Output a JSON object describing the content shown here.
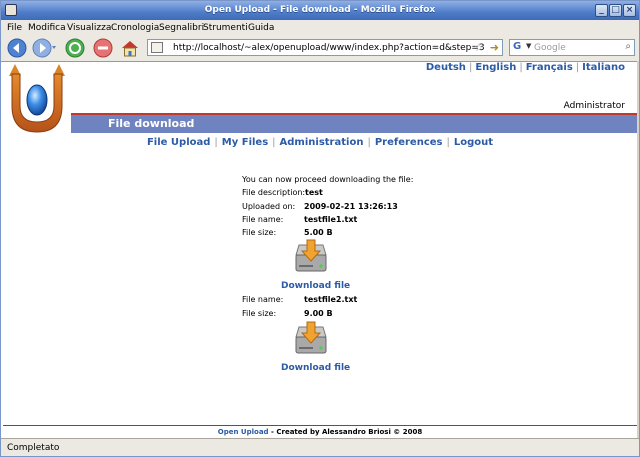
{
  "window": {
    "title": "Open Upload - File download - Mozilla Firefox"
  },
  "menu": [
    "File",
    "Modifica",
    "Visualizza",
    "Cronologia",
    "Segnalibri",
    "Strumenti",
    "Guida"
  ],
  "address": {
    "url": "http://localhost/~alex/openupload/www/index.php?action=d&step=3"
  },
  "search": {
    "placeholder": "Google"
  },
  "languages": [
    "Deutsh",
    "English",
    "Français",
    "Italiano"
  ],
  "user": {
    "name": "Administrator"
  },
  "page": {
    "header": "File download"
  },
  "nav": [
    "File Upload",
    "My Files",
    "Administration",
    "Preferences",
    "Logout"
  ],
  "download": {
    "intro": "You can now proceed downloading the file:",
    "description_label": "File description:",
    "description": "test",
    "uploaded_label": "Uploaded on:",
    "uploaded": "2009-02-21 13:26:13",
    "files": [
      {
        "name_label": "File name:",
        "name": "testfile1.txt",
        "size_label": "File size:",
        "size": "5.00 B",
        "link": "Download file"
      },
      {
        "name_label": "File name:",
        "name": "testfile2.txt",
        "size_label": "File size:",
        "size": "9.00 B",
        "link": "Download file"
      }
    ]
  },
  "footer": {
    "link": "Open Upload",
    "text": " - Created by Alessandro Briosi © 2008"
  },
  "status": {
    "text": "Completato"
  },
  "colors": {
    "accent": "#2c5ba6",
    "header_bar": "#6e83bf",
    "header_line": "#c0392b"
  }
}
